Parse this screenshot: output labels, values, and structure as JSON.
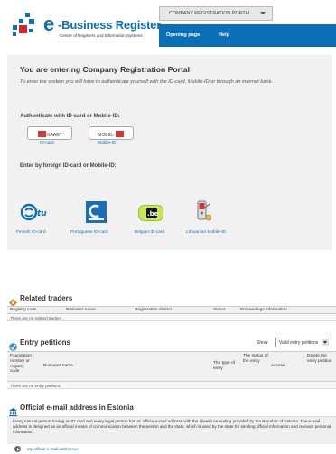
{
  "header": {
    "logo_e": "e",
    "logo_title": "-Business Register",
    "logo_subtitle": "Centre of Registers and Information Systems",
    "portal_select": "COMPANY REGISTRATION PORTAL",
    "nav": [
      "Opening page",
      "Help"
    ],
    "brand_color": "#0b6fb5"
  },
  "portal": {
    "title": "You are entering Company Registration Portal",
    "intro": "To enter the system you will have to authenticate yourself with the ID-card, Mobile-ID or through an internet bank.",
    "auth_heading": "Authenticate with ID-card or Mobile-ID:",
    "auth_buttons": [
      {
        "label": "KAART",
        "caption": "ID-card"
      },
      {
        "label": "MOBIIL-",
        "caption": "Mobile-ID"
      }
    ],
    "foreign_heading": "Enter by foreign ID-card or Mobile-ID:",
    "foreign": [
      {
        "icon": "finnish-id-icon",
        "caption": "Finnish ID-card"
      },
      {
        "icon": "portuguese-id-icon",
        "caption": "Portuguese ID-card"
      },
      {
        "icon": "belgian-id-icon",
        "caption": "Belgian ID-card"
      },
      {
        "icon": "lithuanian-mobile-id-icon",
        "caption": "Lithuanian Mobile-ID"
      }
    ],
    "finnish_logo_text": "tu",
    "belgian_logo_text": ".be"
  },
  "related_traders": {
    "title": "Related traders",
    "columns": [
      "Registry code",
      "Business name",
      "Registration district",
      "Status",
      "Proceedings information"
    ],
    "empty": "There are no related traders"
  },
  "entry_petitions": {
    "title": "Entry petitions",
    "show_label": "Show",
    "show_value": "Valid entry petitions",
    "columns": [
      "Foundation number or registry code",
      "Business name",
      "The type of entry",
      "The status of the entry",
      "Access",
      "Delete the entry petition"
    ],
    "empty": "There are no entry petitions"
  },
  "official_email": {
    "title": "Official e-mail address in Estonia",
    "text": "Every natural person having an ID card and every legal person has an official e-mail address with the @eesti.ee ending provided by the Republic of Estonia. The e-mail address is designed as an official means of communication between the person and the state, which is used by the state for sending official information and relevant personal information.",
    "link": "My official e-mail addresses"
  }
}
